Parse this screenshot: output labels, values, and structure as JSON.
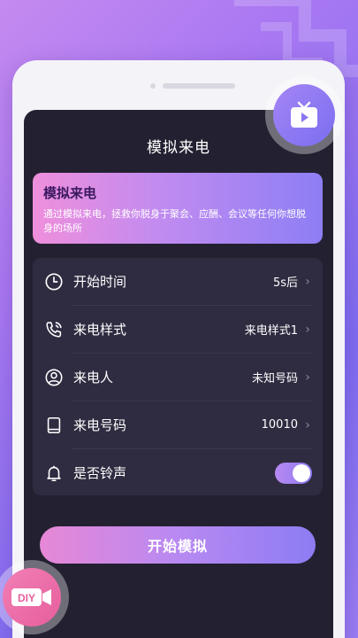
{
  "screen": {
    "title": "模拟来电"
  },
  "banner": {
    "title": "模拟来电",
    "description": "通过模拟来电，拯救你脱身于聚会、应酬、会议等任何你想脱身的场所"
  },
  "settings": [
    {
      "label": "开始时间",
      "value": "5s后",
      "icon": "clock-icon"
    },
    {
      "label": "来电样式",
      "value": "来电样式1",
      "icon": "phone-ring-icon"
    },
    {
      "label": "来电人",
      "value": "未知号码",
      "icon": "person-icon"
    },
    {
      "label": "来电号码",
      "value": "10010",
      "icon": "tablet-icon"
    },
    {
      "label": "是否铃声",
      "value": "",
      "icon": "bell-icon",
      "toggle_on": true
    }
  ],
  "start_button": {
    "label": "开始模拟"
  },
  "badges": {
    "tv": "tv-play-icon",
    "diy": "DIY"
  },
  "colors": {
    "screen_bg": "#232131",
    "card_bg": "#2f2c41",
    "accent": "#b889f2"
  }
}
